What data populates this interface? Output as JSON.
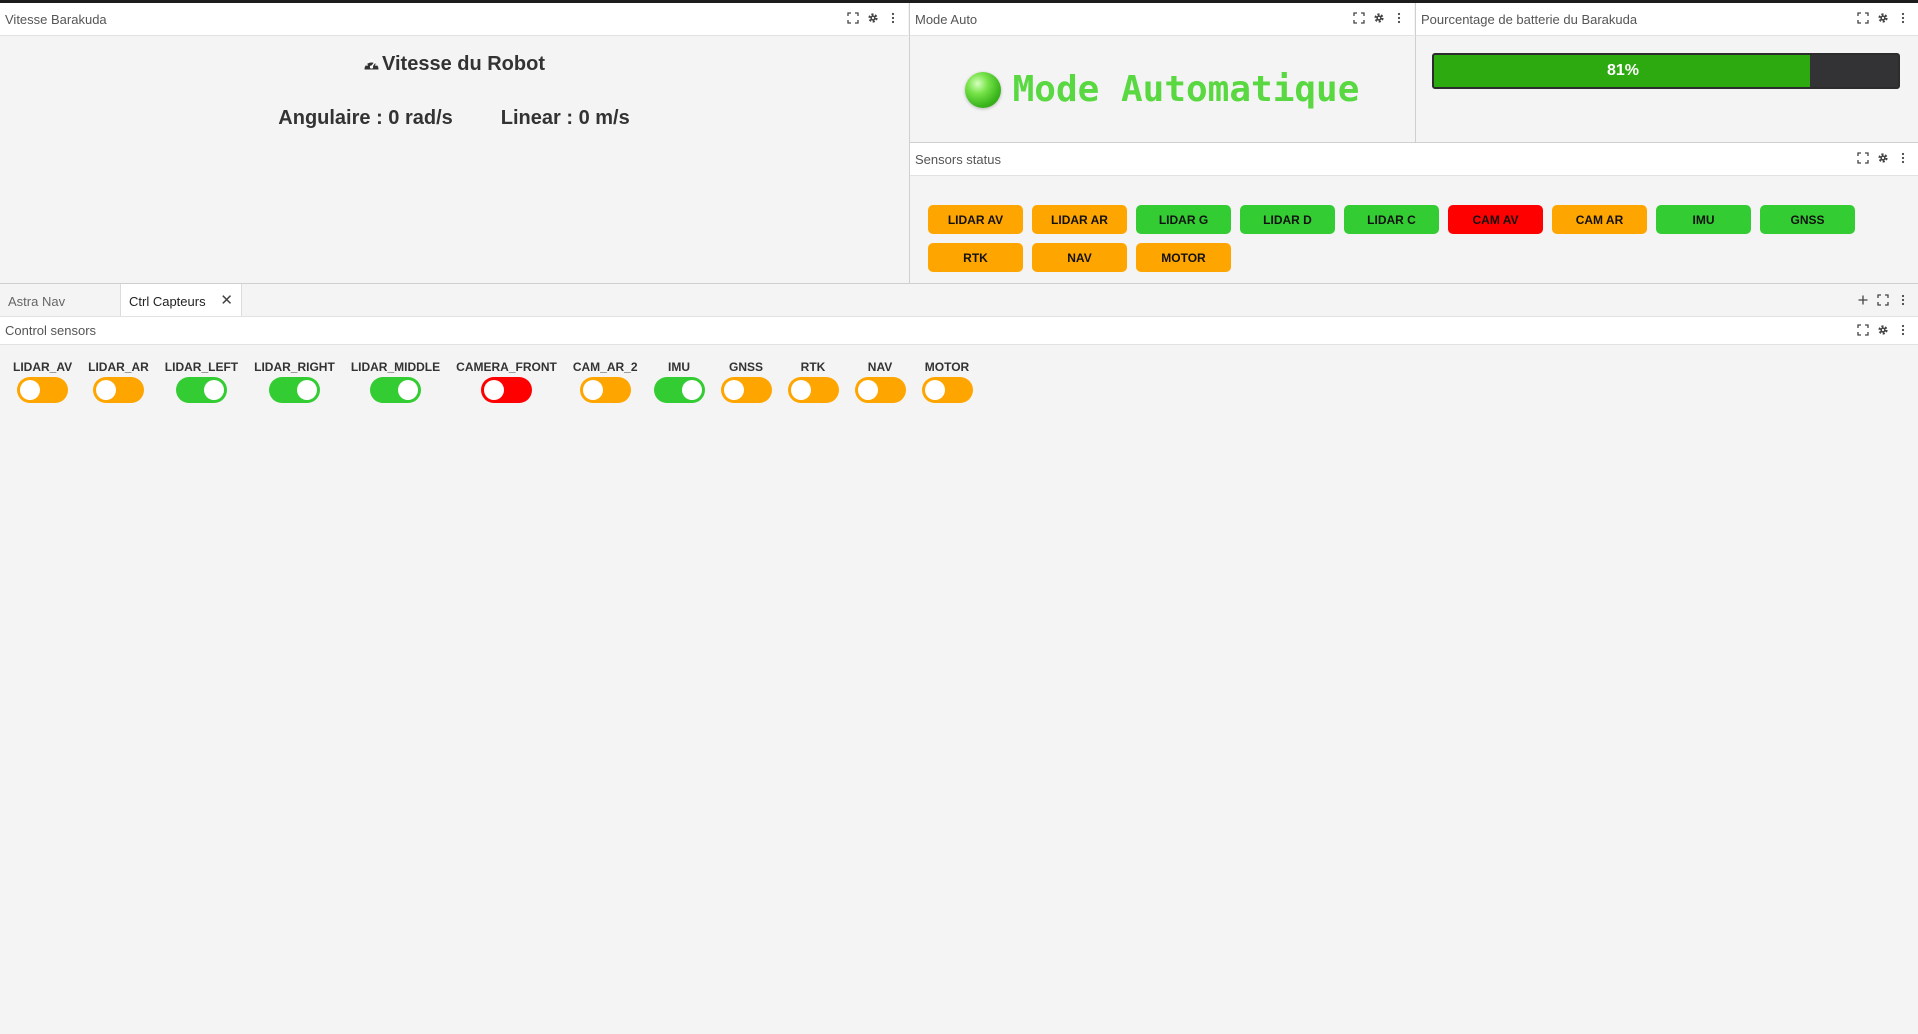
{
  "panels": {
    "speed": {
      "title": "Vitesse Barakuda",
      "heading": "Vitesse du Robot",
      "angular": "Angulaire : 0 rad/s",
      "linear": "Linear : 0 m/s"
    },
    "mode": {
      "title": "Mode Auto",
      "text": "Mode Automatique",
      "color": "#5ad841"
    },
    "battery": {
      "title": "Pourcentage de batterie du Barakuda",
      "label": "81%",
      "fraction": 0.81,
      "fill_color": "#2eaa11",
      "track_color": "#333336"
    },
    "sensors_status": {
      "title": "Sensors status",
      "chips": [
        {
          "label": "LIDAR AV",
          "color": "#ffa500"
        },
        {
          "label": "LIDAR AR",
          "color": "#ffa500"
        },
        {
          "label": "LIDAR G",
          "color": "#33cc33"
        },
        {
          "label": "LIDAR D",
          "color": "#33cc33"
        },
        {
          "label": "LIDAR C",
          "color": "#33cc33"
        },
        {
          "label": "CAM AV",
          "color": "#ff0000"
        },
        {
          "label": "CAM AR",
          "color": "#ffa500"
        },
        {
          "label": "IMU",
          "color": "#33cc33"
        },
        {
          "label": "GNSS",
          "color": "#33cc33"
        },
        {
          "label": "RTK",
          "color": "#ffa500"
        },
        {
          "label": "NAV",
          "color": "#ffa500"
        },
        {
          "label": "MOTOR",
          "color": "#ffa500"
        }
      ]
    },
    "control_sensors": {
      "title": "Control sensors",
      "toggles": [
        {
          "label": "LIDAR_AV",
          "state": "off",
          "color": "#ffa500"
        },
        {
          "label": "LIDAR_AR",
          "state": "off",
          "color": "#ffa500"
        },
        {
          "label": "LIDAR_LEFT",
          "state": "on",
          "color": "#33cc33"
        },
        {
          "label": "LIDAR_RIGHT",
          "state": "on",
          "color": "#33cc33"
        },
        {
          "label": "LIDAR_MIDDLE",
          "state": "on",
          "color": "#33cc33"
        },
        {
          "label": "CAMERA_FRONT",
          "state": "off",
          "color": "#ff0000"
        },
        {
          "label": "CAM_AR_2",
          "state": "off",
          "color": "#ffa500"
        },
        {
          "label": "IMU",
          "state": "on",
          "color": "#33cc33"
        },
        {
          "label": "GNSS",
          "state": "off",
          "color": "#ffa500"
        },
        {
          "label": "RTK",
          "state": "off",
          "color": "#ffa500"
        },
        {
          "label": "NAV",
          "state": "off",
          "color": "#ffa500"
        },
        {
          "label": "MOTOR",
          "state": "off",
          "color": "#ffa500"
        }
      ]
    }
  },
  "tabs": [
    {
      "label": "Astra Nav",
      "active": false
    },
    {
      "label": "Ctrl Capteurs",
      "active": true
    }
  ],
  "icons": {
    "fullscreen": "fullscreen-icon",
    "settings": "gear-icon",
    "menu": "more-vertical-icon",
    "add": "plus-icon",
    "close": "close-icon",
    "gauge": "gauge-icon"
  }
}
